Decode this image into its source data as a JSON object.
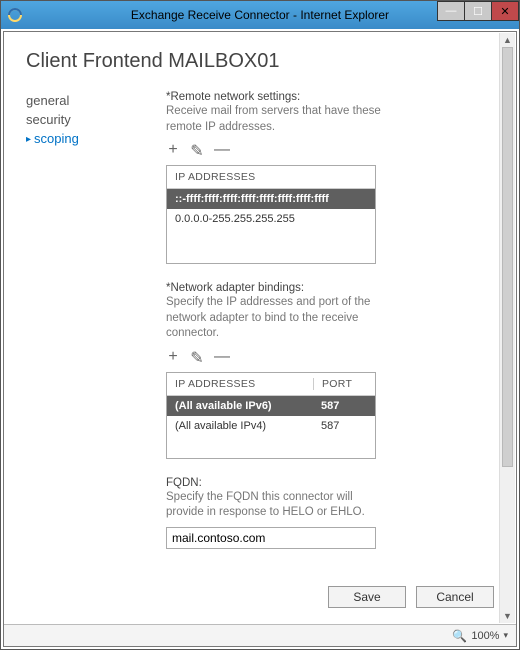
{
  "window": {
    "title": "Exchange Receive Connector - Internet Explorer"
  },
  "page": {
    "title": "Client Frontend MAILBOX01"
  },
  "sidebar": {
    "items": [
      {
        "label": "general",
        "active": false
      },
      {
        "label": "security",
        "active": false
      },
      {
        "label": "scoping",
        "active": true
      }
    ]
  },
  "remote": {
    "heading": "*Remote network settings:",
    "help": "Receive mail from servers that have these remote IP addresses.",
    "column": "IP ADDRESSES",
    "rows": [
      {
        "value": "::-ffff:ffff:ffff:ffff:ffff:ffff:ffff:ffff",
        "selected": true
      },
      {
        "value": "0.0.0.0-255.255.255.255",
        "selected": false
      }
    ]
  },
  "bindings": {
    "heading": "*Network adapter bindings:",
    "help": "Specify the IP addresses and port of the network adapter to bind to the receive connector.",
    "col_ip": "IP ADDRESSES",
    "col_port": "PORT",
    "rows": [
      {
        "ip": "(All available IPv6)",
        "port": "587",
        "selected": true
      },
      {
        "ip": "(All available IPv4)",
        "port": "587",
        "selected": false
      }
    ]
  },
  "fqdn": {
    "heading": "FQDN:",
    "help": "Specify the FQDN this connector will provide in response to HELO or EHLO.",
    "value": "mail.contoso.com"
  },
  "buttons": {
    "save": "Save",
    "cancel": "Cancel"
  },
  "status": {
    "zoom": "100%"
  },
  "icons": {
    "add": "+",
    "edit": "✎",
    "remove": "—",
    "min": "—",
    "max": "☐",
    "close": "✕",
    "zoom": "🔍",
    "dd": "▾",
    "up": "▲",
    "down": "▼"
  }
}
